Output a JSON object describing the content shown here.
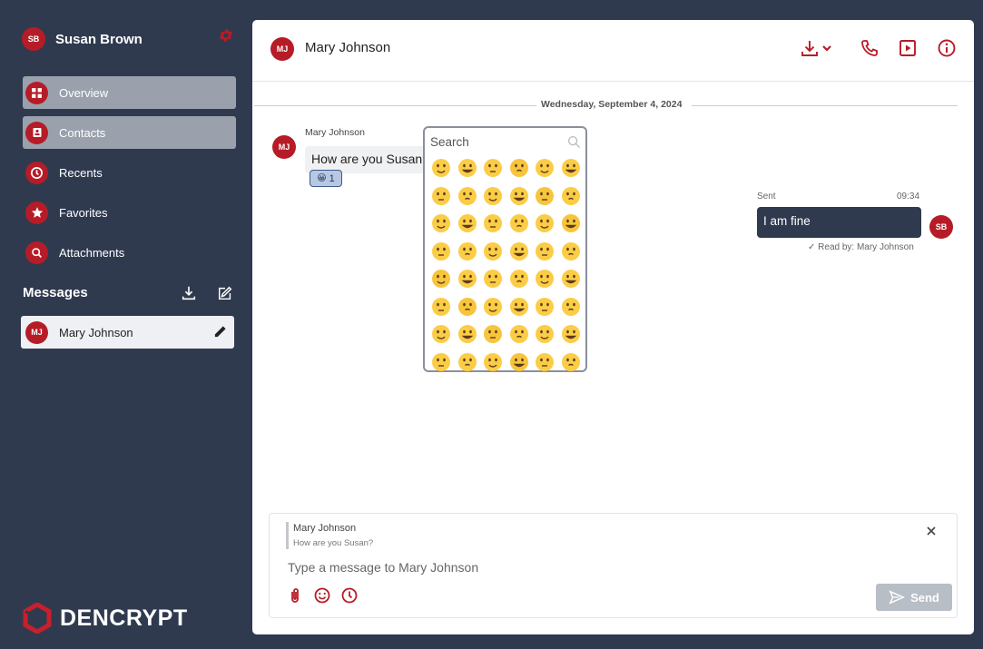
{
  "colors": {
    "brand_red": "#b61c27",
    "sidebar_bg": "#2f3a4f",
    "nav_active_bg": "#9aa1ad",
    "send_disabled": "#b8bec6"
  },
  "user": {
    "initials": "SB",
    "name": "Susan Brown",
    "settings_icon": "gear-icon"
  },
  "nav": {
    "items": [
      {
        "label": "Overview",
        "icon": "grid-icon",
        "active": true
      },
      {
        "label": "Contacts",
        "icon": "contact-card-icon",
        "active": true
      },
      {
        "label": "Recents",
        "icon": "clock-icon",
        "active": false
      },
      {
        "label": "Favorites",
        "icon": "star-icon",
        "active": false
      },
      {
        "label": "Attachments",
        "icon": "search-icon",
        "active": false
      }
    ]
  },
  "messages_section": {
    "title": "Messages",
    "download_icon": "download-icon",
    "compose_icon": "compose-icon"
  },
  "conversations": [
    {
      "initials": "MJ",
      "name": "Mary Johnson",
      "icon": "pencil-icon"
    }
  ],
  "brand": {
    "name": "DENCRYPT"
  },
  "chat": {
    "header": {
      "initials": "MJ",
      "name": "Mary Johnson",
      "actions": [
        "download-dropdown-icon",
        "phone-icon",
        "play-icon",
        "info-icon"
      ]
    },
    "date_separator": "Wednesday, September 4, 2024",
    "incoming": {
      "initials": "MJ",
      "sender": "Mary Johnson",
      "text": "How are you Susan?",
      "reaction": {
        "emoji": "😀",
        "count": "1"
      }
    },
    "outgoing": {
      "initials": "SB",
      "status": "Sent",
      "time": "09:34",
      "text": "I am fine",
      "read_receipt": "✓ Read by: Mary Johnson"
    }
  },
  "emoji_picker": {
    "search_placeholder": "Search",
    "emojis": [
      "grinning",
      "smiley",
      "smile",
      "grin",
      "laughing",
      "sweat-smile",
      "rolling-laughing",
      "joy",
      "slight-smile",
      "upside-down",
      "melting",
      "wink",
      "blush",
      "innocent",
      "hearts-face",
      "heart-eyes",
      "star-struck",
      "kissing-heart",
      "kissing",
      "relaxed",
      "kissing-closed",
      "kissing-smiling",
      "tear-smile",
      "yum",
      "tongue",
      "tongue-wink",
      "zany",
      "squint-tongue",
      "money-mouth",
      "hug",
      "hand-over-mouth",
      "peek",
      "open-hands",
      "shush",
      "thinking",
      "salute",
      "zipper",
      "raised-brow",
      "neutral",
      "expressionless",
      "no-mouth",
      "dotted",
      "clouds",
      "smirk",
      "unamused",
      "eye-roll",
      "grimace",
      "exhale"
    ]
  },
  "composer": {
    "reply_name": "Mary Johnson",
    "reply_text": "How are you Susan?",
    "placeholder": "Type a message to Mary Johnson",
    "send_label": "Send"
  }
}
